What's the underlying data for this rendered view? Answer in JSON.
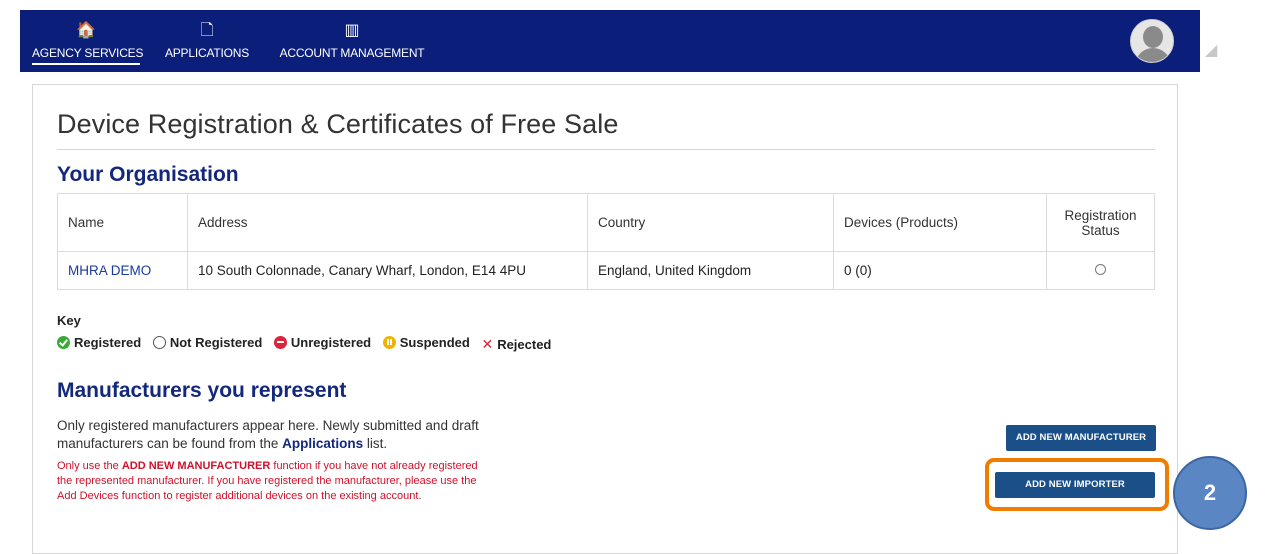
{
  "nav": {
    "items": [
      {
        "label": "AGENCY SERVICES",
        "icon": "home-icon",
        "glyph": "🏠"
      },
      {
        "label": "APPLICATIONS",
        "icon": "document-icon",
        "glyph": "🗋"
      },
      {
        "label": "ACCOUNT MANAGEMENT",
        "icon": "building-icon",
        "glyph": "▥"
      }
    ]
  },
  "page": {
    "title": "Device Registration & Certificates of Free Sale"
  },
  "organisation": {
    "heading": "Your Organisation",
    "columns": [
      "Name",
      "Address",
      "Country",
      "Devices (Products)",
      "Registration Status"
    ],
    "row": {
      "name": "MHRA DEMO",
      "address": "10 South Colonnade, Canary Wharf, London, E14 4PU",
      "country": "England, United Kingdom",
      "devices": "0 (0)",
      "status": "not-registered"
    }
  },
  "key": {
    "title": "Key",
    "items": [
      {
        "label": "Registered",
        "icon": "check-circle-icon"
      },
      {
        "label": "Not Registered",
        "icon": "empty-circle-icon"
      },
      {
        "label": "Unregistered",
        "icon": "minus-circle-icon"
      },
      {
        "label": "Suspended",
        "icon": "pause-circle-icon"
      },
      {
        "label": "Rejected",
        "icon": "x-icon"
      }
    ]
  },
  "manufacturers": {
    "heading": "Manufacturers you represent",
    "desc_before": "Only registered manufacturers appear here. Newly submitted and draft manufacturers can be found from the ",
    "desc_link": "Applications",
    "desc_after": " list.",
    "warn_before": "Only use the ",
    "warn_bold": "ADD NEW MANUFACTURER",
    "warn_after": " function if you have not already registered the represented manufacturer. If you have registered the manufacturer, please use the Add Devices function to register additional devices on the existing account.",
    "add_manufacturer_label": "ADD NEW MANUFACTURER",
    "add_importer_label": "ADD NEW IMPORTER"
  },
  "annotation": {
    "step_number": "2",
    "highlight_color": "#f07d00",
    "badge_color": "#5b86c4"
  },
  "colors": {
    "nav_bg": "#0b1f7a",
    "heading": "#13287b",
    "button": "#1b4f88",
    "warning": "#d0112b"
  }
}
